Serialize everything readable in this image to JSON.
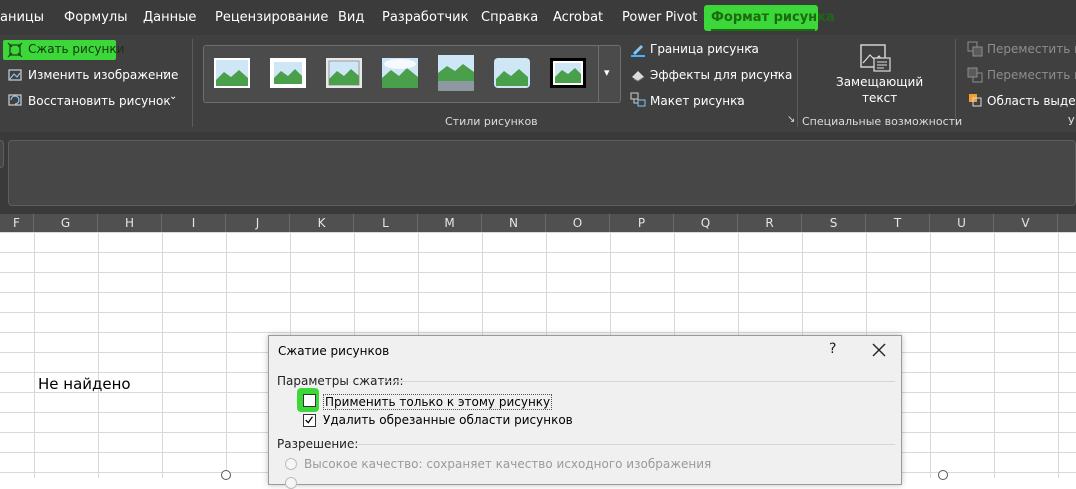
{
  "menu_tabs": [
    {
      "label": "аницы"
    },
    {
      "label": "Формулы"
    },
    {
      "label": "Данные"
    },
    {
      "label": "Рецензирование"
    },
    {
      "label": "Вид"
    },
    {
      "label": "Разработчик"
    },
    {
      "label": "Справка"
    },
    {
      "label": "Acrobat"
    },
    {
      "label": "Power Pivot"
    },
    {
      "label": "Формат рисунка",
      "active": true
    }
  ],
  "ribbon": {
    "adjust": {
      "compress": "Сжать рисунки",
      "change": "Изменить изображение",
      "reset": "Восстановить рисунок"
    },
    "styles_group_label": "Стили рисунков",
    "styles": {
      "border": "Граница рисунка",
      "effects": "Эффекты для рисунка",
      "layout": "Макет рисунка"
    },
    "accessibility": {
      "alt_text_line1": "Замещающий",
      "alt_text_line2": "текст",
      "group_label": "Специальные возможности"
    },
    "arrange": {
      "forward": "Переместить впе",
      "backward": "Переместить на",
      "selection": "Область выделе",
      "group_label_stub": "У"
    }
  },
  "columns": [
    "F",
    "G",
    "H",
    "I",
    "J",
    "K",
    "L",
    "M",
    "N",
    "O",
    "P",
    "Q",
    "R",
    "S",
    "T",
    "U",
    "V"
  ],
  "cell_text": "Не найдено",
  "dialog": {
    "title": "Сжатие рисунков",
    "help": "?",
    "section_params": "Параметры сжатия:",
    "option_apply_only": "Применить только к этому рисунку",
    "option_apply_only_checked": false,
    "option_delete_cropped": "Удалить обрезанные области рисунков",
    "option_delete_cropped_checked": true,
    "section_resolution": "Разрешение:",
    "resolution_high": "Высокое качество: сохраняет качество исходного изображения"
  },
  "colors": {
    "highlight_green": "#3cd83a",
    "active_tab_text": "#4ed33c",
    "ribbon_bg": "#404040",
    "menubar_bg": "#3b3b3b"
  }
}
